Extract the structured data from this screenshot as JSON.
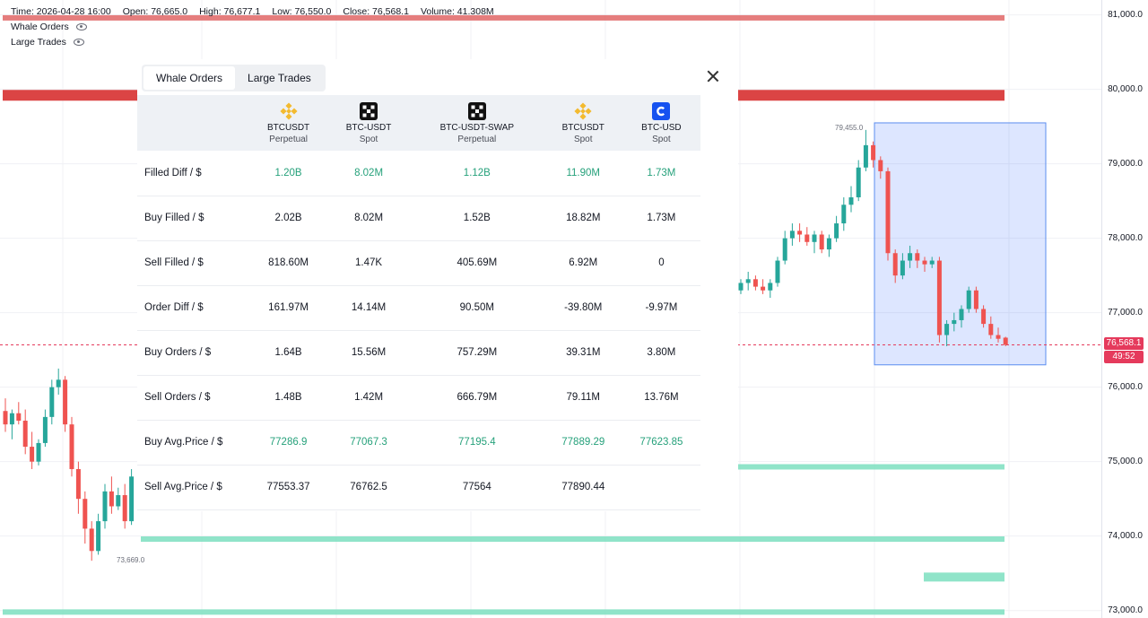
{
  "legend": {
    "time": "Time: 2026-04-28 16:00",
    "open": "Open: 76,665.0",
    "high": "High: 76,677.1",
    "low": "Low: 76,550.0",
    "close": "Close: 76,568.1",
    "volume": "Volume: 41.308M"
  },
  "indicators": [
    {
      "label": "Whale Orders",
      "icon": "eye-icon"
    },
    {
      "label": "Large Trades",
      "icon": "eye-icon"
    }
  ],
  "price_scale": [
    "81,000.0",
    "80,000.0",
    "79,000.0",
    "78,000.0",
    "77,000.0",
    "76,000.0",
    "75,000.0",
    "74,000.0",
    "73,000.0"
  ],
  "current_price": {
    "price": "76,568.1",
    "countdown": "49:52"
  },
  "markers": {
    "high": "79,455.0",
    "low": "73,669.0"
  },
  "colors": {
    "up": "#26a69a",
    "down": "#ef5350",
    "sell_wall": "#e06666",
    "buy_wall": "#7ddfbf",
    "selection": "#2962ff"
  },
  "panel": {
    "tabs": [
      "Whale Orders",
      "Large Trades"
    ],
    "active_tab": "Whale Orders",
    "columns": [
      {
        "symbol": "BTCUSDT",
        "type": "Perpetual",
        "logo": "binance-logo-icon"
      },
      {
        "symbol": "BTC-USDT",
        "type": "Spot",
        "logo": "okx-logo-icon"
      },
      {
        "symbol": "BTC-USDT-SWAP",
        "type": "Perpetual",
        "logo": "okx-logo-icon"
      },
      {
        "symbol": "BTCUSDT",
        "type": "Spot",
        "logo": "binance-logo-icon"
      },
      {
        "symbol": "BTC-USD",
        "type": "Spot",
        "logo": "coinbase-logo-icon"
      }
    ],
    "rows": [
      {
        "label": "Filled Diff / $",
        "values": [
          "1.20B",
          "8.02M",
          "1.12B",
          "11.90M",
          "1.73M"
        ],
        "highlight": true
      },
      {
        "label": "Buy Filled / $",
        "values": [
          "2.02B",
          "8.02M",
          "1.52B",
          "18.82M",
          "1.73M"
        ],
        "highlight": false
      },
      {
        "label": "Sell Filled / $",
        "values": [
          "818.60M",
          "1.47K",
          "405.69M",
          "6.92M",
          "0"
        ],
        "highlight": false
      },
      {
        "label": "Order Diff / $",
        "values": [
          "161.97M",
          "14.14M",
          "90.50M",
          "-39.80M",
          "-9.97M"
        ],
        "highlight": false
      },
      {
        "label": "Buy Orders / $",
        "values": [
          "1.64B",
          "15.56M",
          "757.29M",
          "39.31M",
          "3.80M"
        ],
        "highlight": false
      },
      {
        "label": "Sell Orders / $",
        "values": [
          "1.48B",
          "1.42M",
          "666.79M",
          "79.11M",
          "13.76M"
        ],
        "highlight": false
      },
      {
        "label": "Buy Avg.Price / $",
        "values": [
          "77286.9",
          "77067.3",
          "77195.4",
          "77889.29",
          "77623.85"
        ],
        "highlight": true
      },
      {
        "label": "Sell Avg.Price / $",
        "values": [
          "77553.37",
          "76762.5",
          "77564",
          "77890.44",
          ""
        ],
        "highlight": false
      }
    ]
  },
  "chart_data": {
    "type": "candlestick",
    "ylim": [
      72900,
      81200
    ],
    "current_price": 76568.1,
    "price_levels": [
      {
        "side": "sell",
        "price": 80960
      },
      {
        "side": "sell",
        "price": 79920
      },
      {
        "side": "buy",
        "price": 74930
      },
      {
        "side": "buy",
        "price": 73960
      },
      {
        "side": "buy",
        "price": 73450
      },
      {
        "side": "buy",
        "price": 72980
      }
    ],
    "selection_range": {
      "price_high": 79550,
      "price_low": 76300
    },
    "left_candles": [
      [
        75680,
        75850,
        75400,
        75500
      ],
      [
        75500,
        75700,
        75300,
        75650
      ],
      [
        75650,
        75800,
        75500,
        75550
      ],
      [
        75550,
        75700,
        75100,
        75200
      ],
      [
        75200,
        75400,
        74900,
        75000
      ],
      [
        75000,
        75300,
        74950,
        75250
      ],
      [
        75250,
        75700,
        75200,
        75600
      ],
      [
        75600,
        76100,
        75500,
        76000
      ],
      [
        76000,
        76250,
        75900,
        76100
      ],
      [
        76100,
        76150,
        75400,
        75500
      ],
      [
        75500,
        75600,
        74800,
        74900
      ],
      [
        74900,
        75000,
        74300,
        74500
      ],
      [
        74500,
        74600,
        73900,
        74100
      ],
      [
        74100,
        74200,
        73669,
        73800
      ],
      [
        73800,
        74300,
        73750,
        74200
      ],
      [
        74200,
        74700,
        74100,
        74600
      ],
      [
        74600,
        74800,
        74300,
        74400
      ],
      [
        74400,
        74650,
        74350,
        74550
      ],
      [
        74550,
        74700,
        74100,
        74200
      ],
      [
        74200,
        74900,
        74150,
        74800
      ]
    ],
    "right_candles": [
      [
        77300,
        77450,
        77250,
        77400
      ],
      [
        77400,
        77550,
        77300,
        77450
      ],
      [
        77450,
        77500,
        77300,
        77350
      ],
      [
        77350,
        77450,
        77250,
        77300
      ],
      [
        77300,
        77450,
        77200,
        77400
      ],
      [
        77400,
        77750,
        77350,
        77700
      ],
      [
        77700,
        78100,
        77650,
        78000
      ],
      [
        78000,
        78200,
        77900,
        78100
      ],
      [
        78100,
        78200,
        77950,
        78050
      ],
      [
        78050,
        78150,
        77900,
        77950
      ],
      [
        77950,
        78100,
        77800,
        78050
      ],
      [
        78050,
        78100,
        77800,
        77850
      ],
      [
        77850,
        78050,
        77750,
        78000
      ],
      [
        78000,
        78300,
        77950,
        78200
      ],
      [
        78200,
        78550,
        78100,
        78450
      ],
      [
        78450,
        78700,
        78350,
        78550
      ],
      [
        78550,
        79050,
        78500,
        78950
      ],
      [
        78950,
        79455,
        78900,
        79250
      ],
      [
        79250,
        79300,
        78950,
        79050
      ],
      [
        79050,
        79100,
        78800,
        78900
      ],
      [
        78900,
        78950,
        77700,
        77800
      ],
      [
        77800,
        77850,
        77400,
        77500
      ],
      [
        77500,
        77800,
        77450,
        77700
      ],
      [
        77700,
        77900,
        77600,
        77800
      ],
      [
        77800,
        77850,
        77600,
        77700
      ],
      [
        77700,
        77750,
        77550,
        77650
      ],
      [
        77650,
        77750,
        77600,
        77700
      ],
      [
        77700,
        77750,
        76600,
        76700
      ],
      [
        76700,
        76900,
        76550,
        76850
      ],
      [
        76850,
        77000,
        76750,
        76900
      ],
      [
        76900,
        77100,
        76800,
        77050
      ],
      [
        77050,
        77350,
        77000,
        77300
      ],
      [
        77300,
        77350,
        77000,
        77050
      ],
      [
        77050,
        77100,
        76800,
        76850
      ],
      [
        76850,
        76950,
        76650,
        76700
      ],
      [
        76700,
        76800,
        76600,
        76650
      ],
      [
        76665,
        76677.1,
        76550,
        76568.1
      ]
    ]
  }
}
